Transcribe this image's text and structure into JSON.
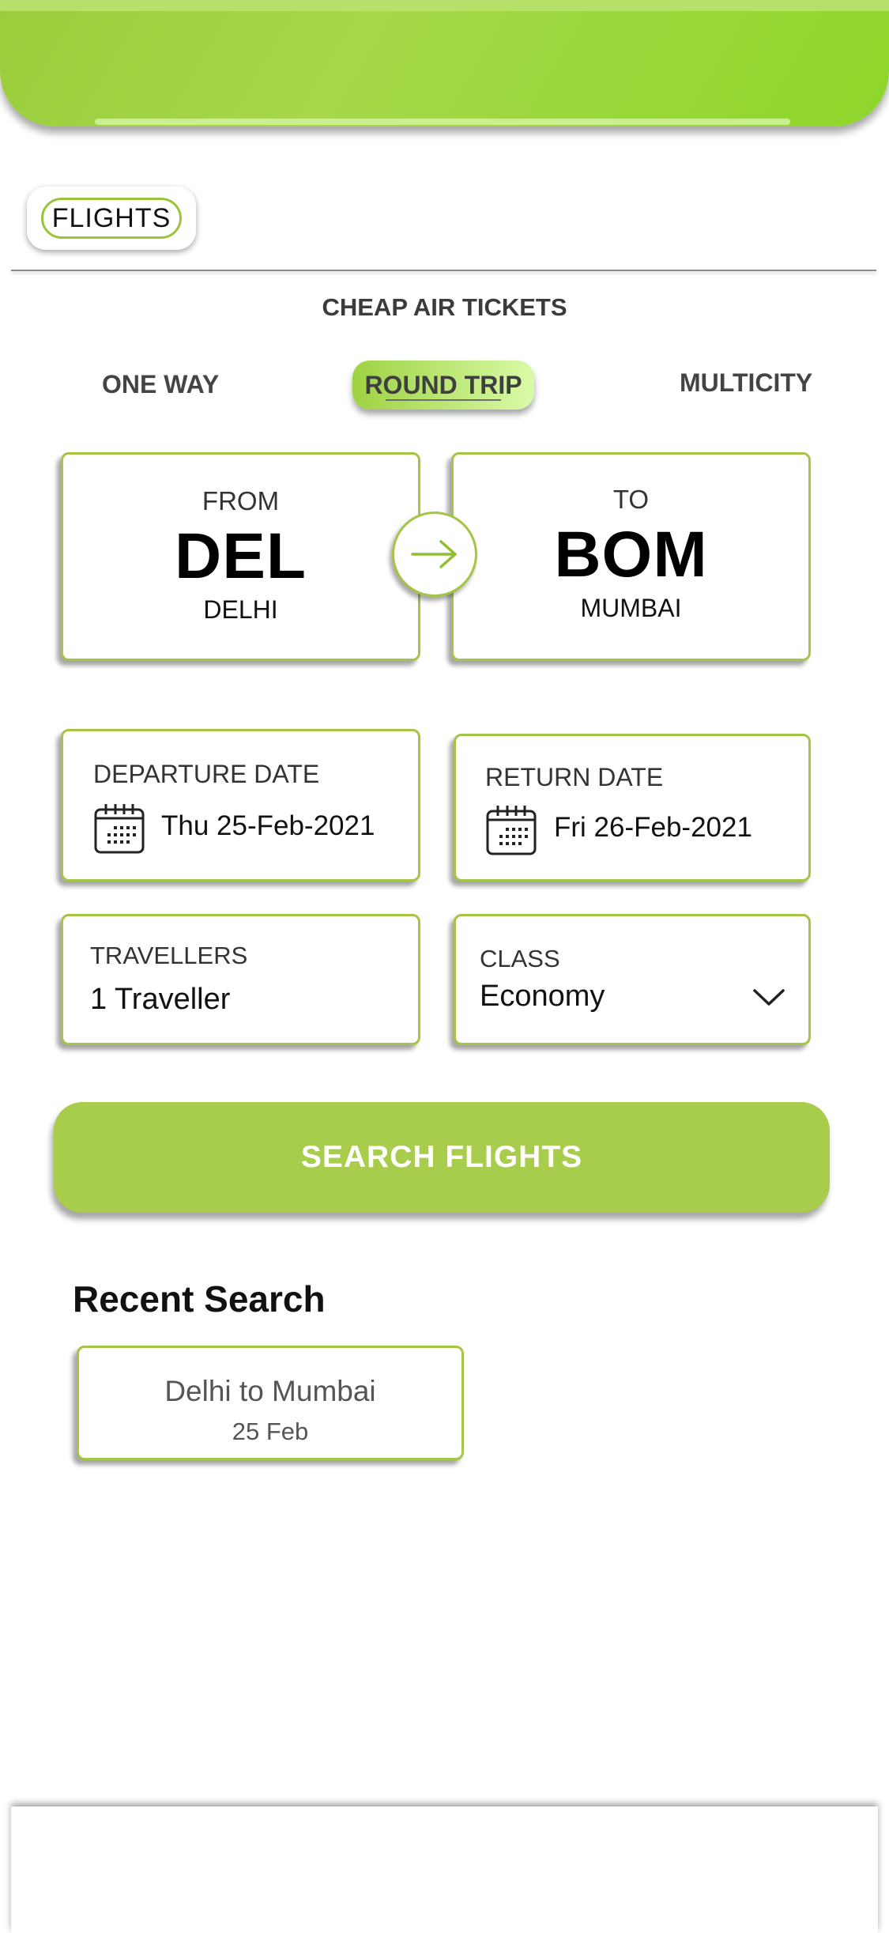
{
  "header": {
    "accent": "#9ed243"
  },
  "category_chip": {
    "label": "FLIGHTS"
  },
  "subtitle": "CHEAP AIR TICKETS",
  "trip_tabs": [
    {
      "label": "ONE WAY",
      "selected": false
    },
    {
      "label": "ROUND TRIP",
      "selected": true
    },
    {
      "label": "MULTICITY",
      "selected": false
    }
  ],
  "from": {
    "label": "FROM",
    "code": "DEL",
    "city": "DELHI"
  },
  "to": {
    "label": "TO",
    "code": "BOM",
    "city": "MUMBAI"
  },
  "swap_icon": "arrow-right-icon",
  "departure": {
    "label": "DEPARTURE DATE",
    "value": "Thu 25-Feb-2021",
    "icon": "calendar-icon"
  },
  "return": {
    "label": "RETURN DATE",
    "value": "Fri 26-Feb-2021",
    "icon": "calendar-icon"
  },
  "travellers": {
    "label": "TRAVELLERS",
    "value": "1 Traveller"
  },
  "cabin_class": {
    "label": "CLASS",
    "value": "Economy",
    "icon": "chevron-down-icon"
  },
  "search_button": {
    "label": "SEARCH FLIGHTS",
    "color": "#a8cc4b"
  },
  "recent": {
    "title": "Recent Search",
    "items": [
      {
        "route": "Delhi to Mumbai",
        "date": "25 Feb"
      }
    ]
  },
  "colors": {
    "border": "#a4c545",
    "text": "#111111"
  }
}
